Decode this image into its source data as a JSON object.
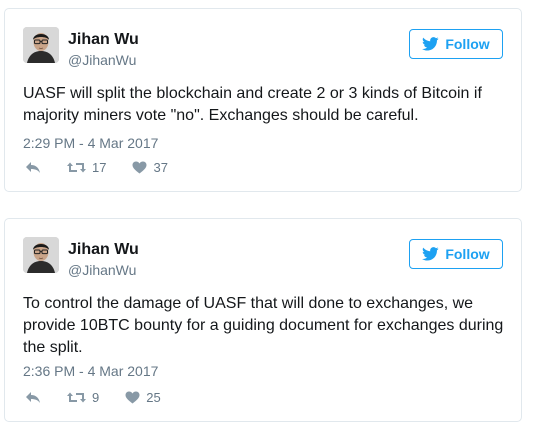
{
  "tweets": [
    {
      "name": "Jihan Wu",
      "handle": "@JihanWu",
      "follow_label": "Follow",
      "text": "UASF will split the blockchain and create 2 or 3 kinds of Bitcoin if majority miners vote \"no\". Exchanges should be careful.",
      "timestamp": "2:29 PM - 4 Mar 2017",
      "retweets": "17",
      "likes": "37",
      "icons": [
        "reply-icon",
        "retweet-icon",
        "heart-icon",
        "twitter-bird-icon"
      ]
    },
    {
      "name": "Jihan Wu",
      "handle": "@JihanWu",
      "follow_label": "Follow",
      "text": "To control the damage of UASF that will done to exchanges, we provide 10BTC bounty for a guiding document for exchanges during the split.",
      "timestamp": "2:36 PM - 4 Mar 2017",
      "retweets": "9",
      "likes": "25",
      "icons": [
        "reply-icon",
        "retweet-icon",
        "heart-icon",
        "twitter-bird-icon"
      ]
    }
  ],
  "colors": {
    "accent": "#1da1f2",
    "text": "#14171a",
    "muted": "#657786",
    "border": "#e1e8ed"
  }
}
